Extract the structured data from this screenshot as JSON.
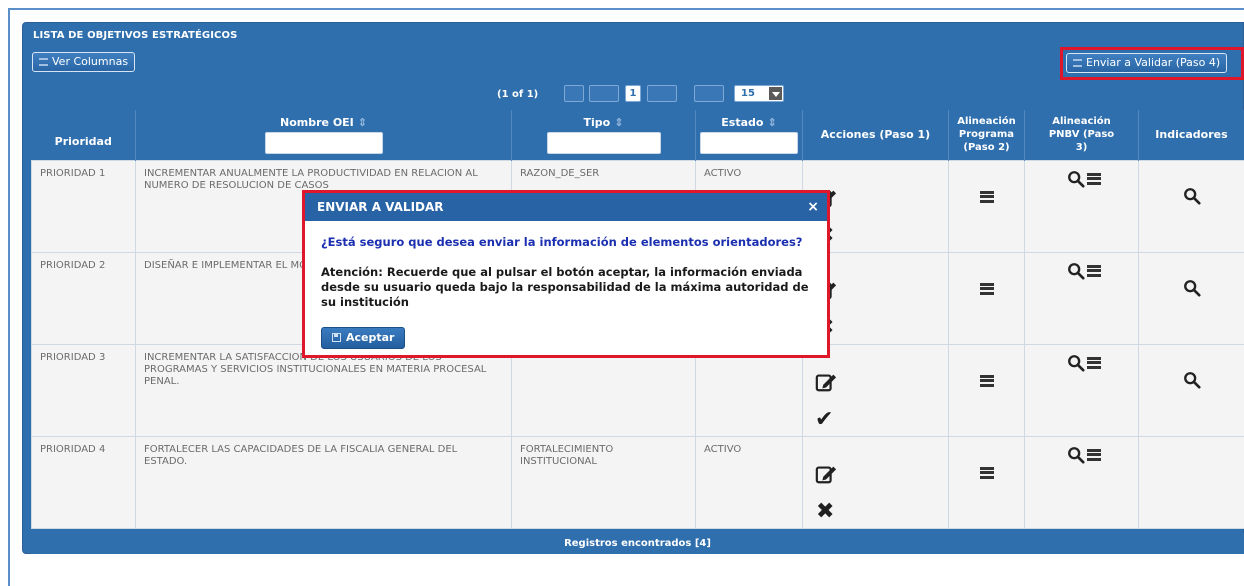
{
  "panel": {
    "title": "LISTA DE OBJETIVOS ESTRATÉGICOS",
    "ver_columnas": "Ver Columnas",
    "enviar_validar": "Enviar a Validar (Paso 4)"
  },
  "paginator": {
    "report": "(1 of 1)",
    "current_page": "1",
    "rows_per_page": "15"
  },
  "columns": {
    "prioridad": "Prioridad",
    "nombre": "Nombre OEI",
    "tipo": "Tipo",
    "estado": "Estado",
    "acciones": "Acciones (Paso 1)",
    "alineacion_programa": "Alineación Programa (Paso 2)",
    "alineacion_pnbv": "Alineación PNBV (Paso 3)",
    "indicadores": "Indicadores"
  },
  "rows": [
    {
      "prioridad": "PRIORIDAD 1",
      "nombre": "INCREMENTAR ANUALMENTE LA PRODUCTIVIDAD EN RELACION AL NUMERO DE RESOLUCION DE CASOS",
      "tipo": "RAZON_DE_SER",
      "estado": "ACTIVO",
      "status_icon": "x-icon"
    },
    {
      "prioridad": "PRIORIDAD 2",
      "nombre": "DISEÑAR E IMPLEMENTAR EL MODELO INTEGRAL DE INVESTIGACION",
      "tipo": "",
      "estado": "",
      "status_icon": "x-icon"
    },
    {
      "prioridad": "PRIORIDAD 3",
      "nombre": "INCREMENTAR LA SATISFACCION DE LOS USUARIOS DE LOS PROGRAMAS Y SERVICIOS INSTITUCIONALES EN MATERIA PROCESAL PENAL.",
      "tipo": "",
      "estado": "",
      "status_icon": "check-icon"
    },
    {
      "prioridad": "PRIORIDAD 4",
      "nombre": "FORTALECER LAS CAPACIDADES DE LA FISCALIA GENERAL DEL ESTADO.",
      "tipo": "FORTALECIMIENTO INSTITUCIONAL",
      "estado": "ACTIVO",
      "status_icon": "x-icon"
    }
  ],
  "footer": "Registros encontrados [4]",
  "modal": {
    "title": "ENVIAR A VALIDAR",
    "close": "×",
    "question": "¿Está seguro que desea enviar la información de elementos orientadores?",
    "message": "Atención: Recuerde que al pulsar el botón aceptar, la información enviada desde su usuario queda bajo la responsabilidad de la máxima autoridad de su institución",
    "accept": "Aceptar"
  },
  "colors": {
    "panel_blue": "#2f6fad",
    "highlight_red": "#e0162a",
    "question_blue": "#1b2fb0"
  }
}
